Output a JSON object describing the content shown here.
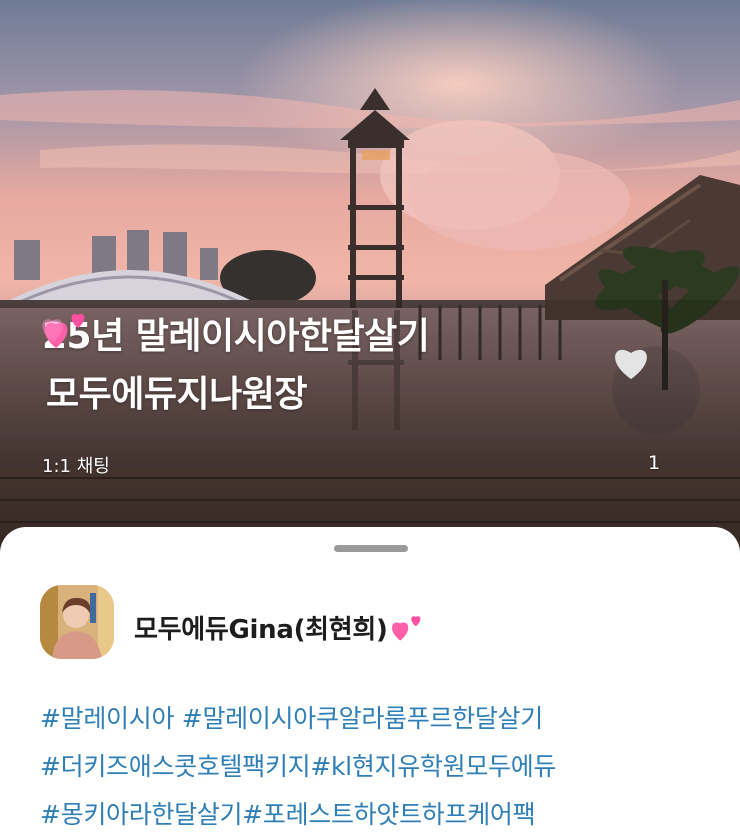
{
  "room": {
    "title_line1": "25년 말레이시아한달살기",
    "title_line2": "모두에듀지나원장",
    "chat_type": "1:1 채팅",
    "like_count": "1"
  },
  "owner": {
    "name": "모두에듀Gina(최현희)"
  },
  "hashtags": {
    "line1": "#말레이시아 #말레이시아쿠알라룸푸르한달살기",
    "line2": "#더키즈애스콧호텔팩키지#kl현지유학원모두에듀",
    "line3": "#몽키아라한달살기#포레스트하얏트하프케어팩"
  },
  "icons": {
    "heart_emoji": "two-hearts-icon",
    "like": "heart-icon"
  },
  "colors": {
    "hashtag": "#2f7fb6",
    "text": "#1d1d1d",
    "handle": "#9a9a9a"
  }
}
